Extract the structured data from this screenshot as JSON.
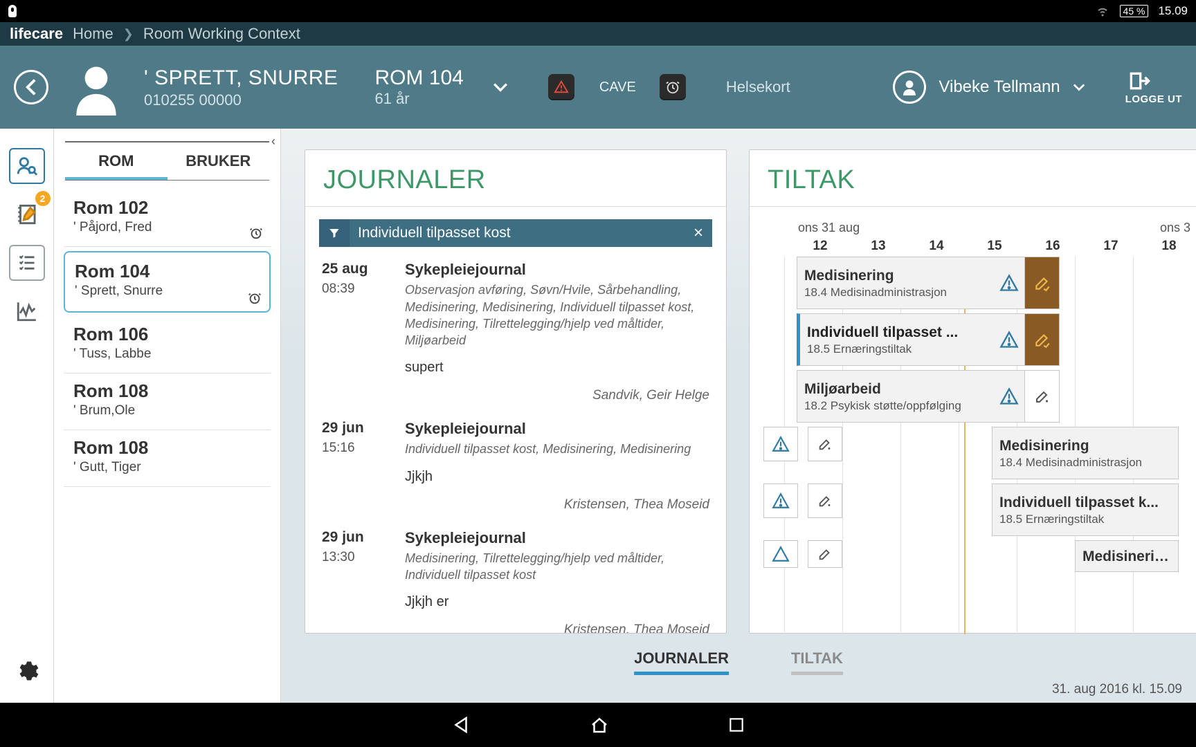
{
  "status": {
    "battery": "45 %",
    "time": "15.09"
  },
  "breadcrumb": {
    "brand": "lifecare",
    "home": "Home",
    "current": "Room Working Context"
  },
  "header": {
    "patient_name": "' SPRETT, SNURRE",
    "patient_id": "010255 00000",
    "room": "ROM 104",
    "age": "61 år",
    "cave": "CAVE",
    "helsekort": "Helsekort",
    "user": "Vibeke Tellmann",
    "logout": "LOGGE UT"
  },
  "iconbar": {
    "notes_badge": "2"
  },
  "roomtabs": {
    "rom": "ROM",
    "bruker": "BRUKER"
  },
  "rooms": [
    {
      "name": "Rom 102",
      "person": "' Påjord, Fred",
      "alarm": true
    },
    {
      "name": "Rom 104",
      "person": "' Sprett, Snurre",
      "alarm": true
    },
    {
      "name": "Rom 106",
      "person": "' Tuss, Labbe"
    },
    {
      "name": "Rom 108",
      "person": "' Brum,Ole"
    },
    {
      "name": "Rom 108",
      "person": "' Gutt, Tiger"
    }
  ],
  "journal": {
    "title": "JOURNALER",
    "filter": "Individuell tilpasset kost",
    "entries": [
      {
        "date": "25 aug",
        "time": "08:39",
        "type": "Sykepleiejournal",
        "tags": "Observasjon avføring, Søvn/Hvile, Sårbehandling, Medisinering, Medisinering, Individuell tilpasset kost, Medisinering, Tilrettelegging/hjelp ved måltider, Miljøarbeid",
        "note": "supert",
        "author": "Sandvik, Geir Helge"
      },
      {
        "date": "29 jun",
        "time": "15:16",
        "type": "Sykepleiejournal",
        "tags": "Individuell tilpasset kost, Medisinering, Medisinering",
        "note": "Jjkjh",
        "author": "Kristensen, Thea Moseid"
      },
      {
        "date": "29 jun",
        "time": "13:30",
        "type": "Sykepleiejournal",
        "tags": "Medisinering, Tilrettelegging/hjelp ved måltider, Individuell tilpasset kost",
        "note": "Jjkjh er",
        "author": "Kristensen, Thea Moseid"
      }
    ]
  },
  "tiltak": {
    "title": "TILTAK",
    "day1": "ons 31 aug",
    "day2": "ons 3",
    "hours": [
      "12",
      "13",
      "14",
      "15",
      "16",
      "17",
      "18"
    ],
    "cards": [
      {
        "title": "Medisinering",
        "sub": "18.4 Medisinadministrasjon",
        "done": true
      },
      {
        "title": "Individuell tilpasset ...",
        "sub": "18.5 Ernæringstiltak",
        "done": true,
        "sel": true
      },
      {
        "title": "Miljøarbeid",
        "sub": "18.2 Psykisk støtte/oppfølging"
      },
      {
        "title": "Medisinering",
        "sub": "18.4 Medisinadministrasjon"
      },
      {
        "title": "Individuell tilpasset k...",
        "sub": "18.5 Ernæringstiltak"
      },
      {
        "title": "Medisinering",
        "sub": ""
      }
    ]
  },
  "bottomtabs": {
    "j": "JOURNALER",
    "t": "TILTAK"
  },
  "footer_time": "31. aug 2016 kl. 15.09"
}
